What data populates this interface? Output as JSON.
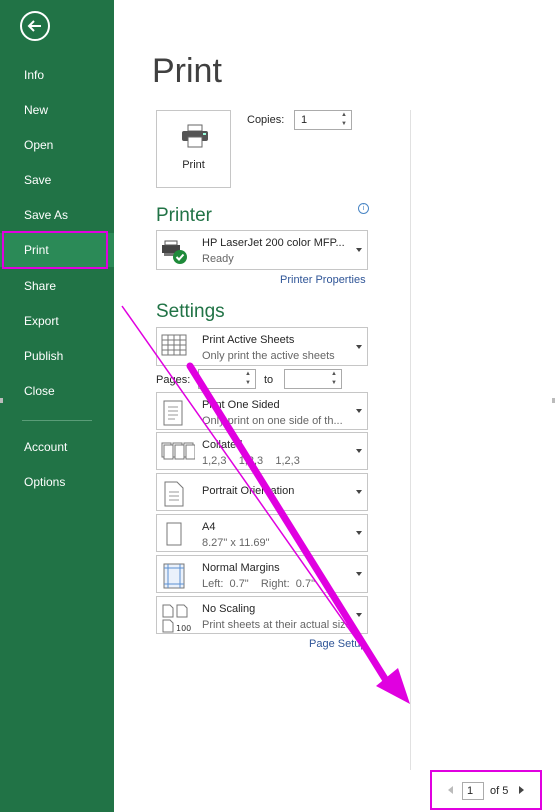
{
  "sidebar": {
    "items": [
      {
        "label": "Info"
      },
      {
        "label": "New"
      },
      {
        "label": "Open"
      },
      {
        "label": "Save"
      },
      {
        "label": "Save As"
      },
      {
        "label": "Print",
        "active": true
      },
      {
        "label": "Share"
      },
      {
        "label": "Export"
      },
      {
        "label": "Publish"
      },
      {
        "label": "Close"
      },
      {
        "label": "Account"
      },
      {
        "label": "Options"
      }
    ],
    "back_icon": "back-arrow-icon"
  },
  "main": {
    "title": "Print",
    "print_button": {
      "label": "Print",
      "icon": "printer-icon"
    },
    "copies": {
      "label": "Copies:",
      "value": "1"
    },
    "printer": {
      "heading": "Printer",
      "name": "HP LaserJet 200 color MFP...",
      "status": "Ready",
      "properties_link": "Printer Properties"
    },
    "settings": {
      "heading": "Settings",
      "sheets": {
        "title": "Print Active Sheets",
        "subtitle": "Only print the active sheets"
      },
      "pages_label": "Pages:",
      "to_label": "to",
      "sided": {
        "title": "Print One Sided",
        "subtitle": "Only print on one side of th..."
      },
      "collated": {
        "title": "Collated",
        "subtitle": "1,2,3    1,2,3    1,2,3"
      },
      "orientation": {
        "title": "Portrait Orientation"
      },
      "paper": {
        "title": "A4",
        "subtitle": "8.27\" x 11.69\""
      },
      "margins": {
        "title": "Normal Margins",
        "subtitle": "Left:  0.7\"    Right:  0.7\""
      },
      "scaling": {
        "title": "No Scaling",
        "subtitle": "Print sheets at their actual size"
      },
      "page_setup_link": "Page Setup"
    },
    "page_nav": {
      "current": "1",
      "of_text": "of 5"
    }
  },
  "colors": {
    "sidebar": "#217346",
    "accent": "#217346",
    "annotation": "#e000e0",
    "link": "#2f5597"
  }
}
